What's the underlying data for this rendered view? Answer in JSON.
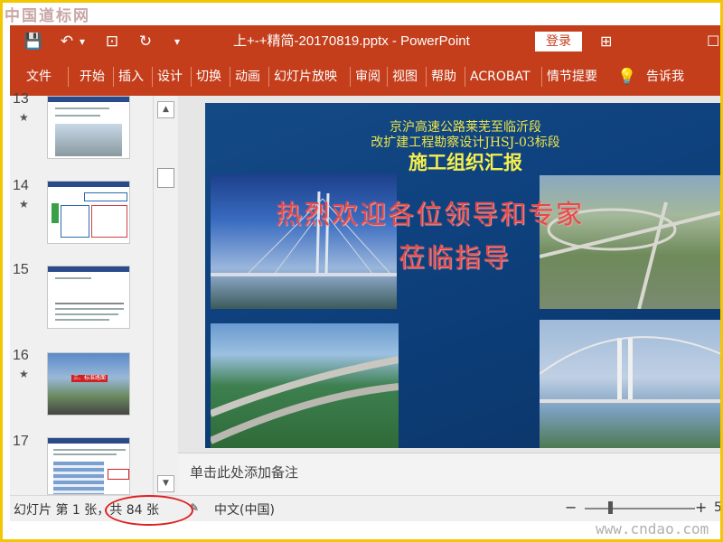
{
  "watermarks": {
    "top": "中国道标网",
    "bottom": "www.cndao.com"
  },
  "titlebar": {
    "doc_title": "上+-+精简-20170819.pptx  -  PowerPoint",
    "login": "登录",
    "quick_access": [
      {
        "name": "save-icon",
        "glyph": "💾"
      },
      {
        "name": "undo-icon",
        "glyph": "↶"
      },
      {
        "name": "undo-dropdown-icon",
        "glyph": "▾"
      },
      {
        "name": "present-icon",
        "glyph": "⊡"
      },
      {
        "name": "refresh-icon",
        "glyph": "↻"
      },
      {
        "name": "customize-qat-icon",
        "glyph": "▾"
      }
    ],
    "window_buttons": [
      {
        "name": "ribbon-display-icon",
        "glyph": "⊞"
      },
      {
        "name": "maximize-icon",
        "glyph": "☐"
      }
    ]
  },
  "ribbon": {
    "tabs": [
      "文件",
      "开始",
      "插入",
      "设计",
      "切换",
      "动画",
      "幻灯片放映",
      "审阅",
      "视图",
      "帮助",
      "ACROBAT",
      "情节提要"
    ],
    "tell_me": "告诉我",
    "tell_me_icon": "lightbulb-icon"
  },
  "thumbnails": [
    {
      "num": "13",
      "star": "★"
    },
    {
      "num": "14",
      "star": "★"
    },
    {
      "num": "15",
      "star": ""
    },
    {
      "num": "16",
      "star": "★"
    },
    {
      "num": "17",
      "star": ""
    }
  ],
  "thumb16_banner": "三、标准路面",
  "slide": {
    "line1": "京沪高速公路莱芜至临沂段",
    "line2": "改扩建工程勘察设计JHSJ-03标段",
    "line3": "施工组织汇报",
    "welcome1": "热烈欢迎各位领导和专家",
    "welcome2": "莅临指导"
  },
  "notes_placeholder": "单击此处添加备注",
  "status": {
    "slide_label": "幻灯片 第 1 张，共 84 张",
    "notes_icon": "notes-icon",
    "language": "中文(中国)",
    "zoom_minus": "−",
    "zoom_plus": "+",
    "zoom_value": "5"
  },
  "colors": {
    "accent": "#c43e1c",
    "slide_bg": "#0d3f7b",
    "title_yellow": "#f0e54a",
    "welcome_red": "#e24b4b"
  }
}
